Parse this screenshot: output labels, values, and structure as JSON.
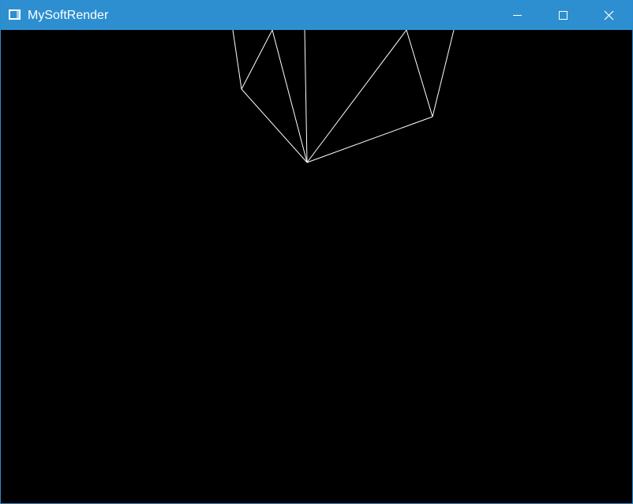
{
  "window": {
    "title": "MySoftRender",
    "accent_color": "#2d8fd0",
    "controls": {
      "minimize_icon": "minimize-icon",
      "maximize_icon": "maximize-icon",
      "close_icon": "close-icon"
    }
  },
  "canvas": {
    "background_color": "#000000",
    "line_color": "#ffffff"
  }
}
